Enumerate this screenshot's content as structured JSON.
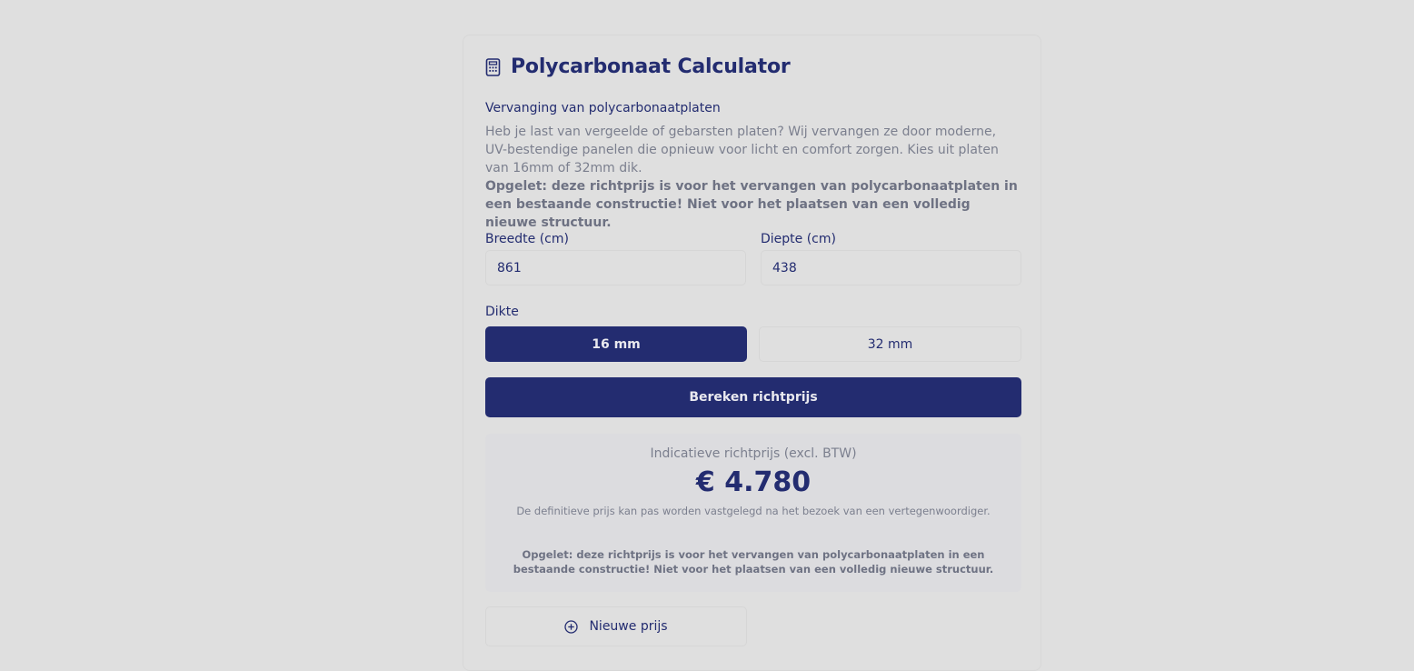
{
  "header": {
    "title": "Polycarbonaat Calculator",
    "icon": "calculator-icon"
  },
  "intro": {
    "subtitle": "Vervanging van polycarbonaatplaten",
    "description": "Heb je last van vergeelde of gebarsten platen? Wij vervangen ze door moderne, UV-bestendige panelen die opnieuw voor licht en comfort zorgen. Kies uit platen van 16mm of 32mm dik.",
    "warning": "Opgelet: deze richtprijs is voor het vervangen van polycarbonaatplaten in een bestaande constructie! Niet voor het plaatsen van een volledig nieuwe structuur."
  },
  "form": {
    "width_label": "Breedte (cm)",
    "width_value": "861",
    "depth_label": "Diepte (cm)",
    "depth_value": "438",
    "thickness_label": "Dikte",
    "thickness_options": [
      "16 mm",
      "32 mm"
    ],
    "thickness_selected": "16 mm",
    "calculate_label": "Bereken richtprijs"
  },
  "result": {
    "label": "Indicatieve richtprijs (excl. BTW)",
    "price": "€ 4.780",
    "note": "De definitieve prijs kan pas worden vastgelegd na het bezoek van een vertegenwoordiger.",
    "warning": "Opgelet: deze richtprijs is voor het vervangen van polycarbonaatplaten in een bestaande constructie! Niet voor het plaatsen van een volledig nieuwe structuur."
  },
  "actions": {
    "new_price_label": "Nieuwe prijs",
    "new_price_icon": "plus-circle-icon"
  },
  "colors": {
    "primary": "#232c70",
    "background": "#dfdfdf",
    "muted_text": "#7b7f8e"
  }
}
